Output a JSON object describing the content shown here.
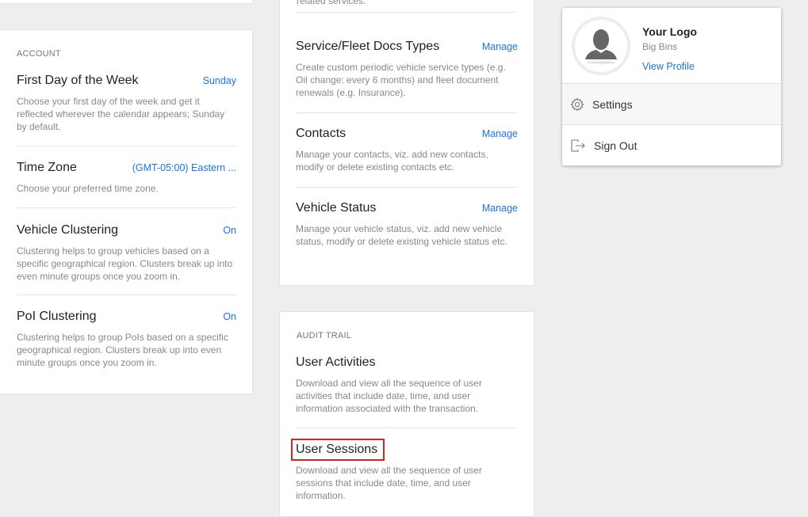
{
  "account": {
    "section": "ACCOUNT",
    "items": [
      {
        "title": "First Day of the Week",
        "value": "Sunday",
        "desc": "Choose your first day of the week and get it reflected wherever the calendar appears; Sunday by default."
      },
      {
        "title": "Time Zone",
        "value": "(GMT-05:00) Eastern ...",
        "desc": "Choose your preferred time zone."
      },
      {
        "title": "Vehicle Clustering",
        "value": "On",
        "desc": "Clustering helps to group vehicles based on a specific geographical region. Clusters break up into even minute groups once you zoom in."
      },
      {
        "title": "PoI Clustering",
        "value": "On",
        "desc": "Clustering helps to group PoIs based on a specific geographical region. Clusters break up into even minute groups once you zoom in."
      }
    ]
  },
  "general": {
    "partial_text": "related services.",
    "items": [
      {
        "title": "Service/Fleet Docs Types",
        "value": "Manage",
        "desc": "Create custom periodic vehicle service types (e.g. Oil change: every 6 months) and fleet document renewals (e.g. Insurance)."
      },
      {
        "title": "Contacts",
        "value": "Manage",
        "desc": "Manage your contacts, viz. add new contacts, modify or delete existing contacts etc."
      },
      {
        "title": "Vehicle Status",
        "value": "Manage",
        "desc": "Manage your vehicle status, viz. add new vehicle status, modify or delete existing vehicle status etc."
      }
    ]
  },
  "audit": {
    "section": "AUDIT TRAIL",
    "items": [
      {
        "title": "User Activities",
        "desc": "Download and view all the sequence of user activities that include date, time, and user information associated with the transaction."
      },
      {
        "title": "User Sessions",
        "desc": "Download and view all the sequence of user sessions that include date, time, and user information."
      }
    ]
  },
  "profile_menu": {
    "name": "Your Logo",
    "org": "Big Bins",
    "view_profile": "View Profile",
    "settings": "Settings",
    "sign_out": "Sign Out",
    "avatar_icon": "user-silhouette-icon"
  },
  "colors": {
    "accent": "#1a73e8",
    "highlight": "#e0201b"
  }
}
